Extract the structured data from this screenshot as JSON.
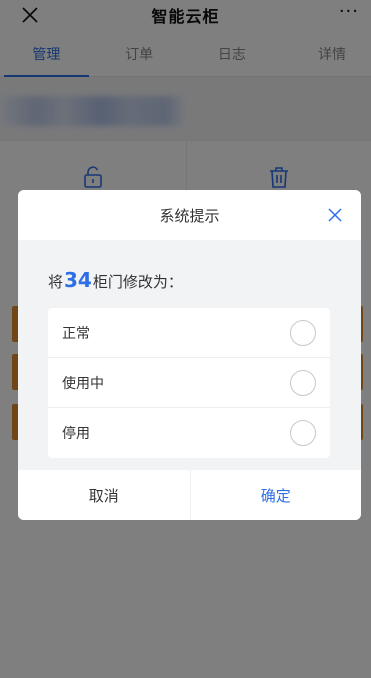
{
  "app": {
    "title": "智能云柜",
    "more_label": "···"
  },
  "tabs": [
    {
      "label": "管理",
      "active": true
    },
    {
      "label": "订单",
      "active": false
    },
    {
      "label": "日志",
      "active": false
    },
    {
      "label": "详情",
      "active": false
    }
  ],
  "actions": [
    {
      "icon": "unlock-icon"
    },
    {
      "icon": "trash-icon"
    }
  ],
  "dialog": {
    "title": "系统提示",
    "prompt_prefix": "将",
    "door_number": "34",
    "prompt_suffix": "柜门修改为：",
    "options": [
      {
        "label": "正常",
        "selected": false
      },
      {
        "label": "使用中",
        "selected": false
      },
      {
        "label": "停用",
        "selected": false
      }
    ],
    "cancel_label": "取消",
    "confirm_label": "确定"
  },
  "colors": {
    "accent": "#2e6ee6",
    "orange_marker": "#e08a2e",
    "overlay": "rgba(0,0,0,0.5)"
  }
}
